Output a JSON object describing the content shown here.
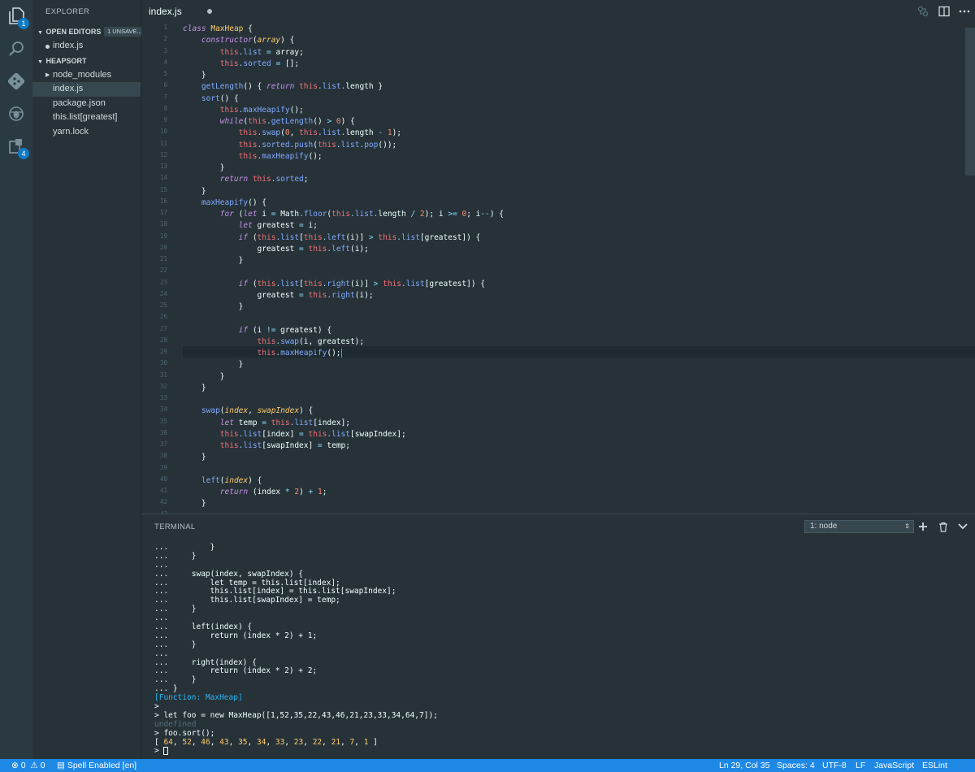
{
  "activity_bar": {
    "explorer_badge": "1",
    "extensions_badge": "4"
  },
  "sidebar": {
    "title": "EXPLORER",
    "open_editors": {
      "label": "OPEN EDITORS",
      "badge": "1 UNSAVE...",
      "items": [
        "index.js"
      ]
    },
    "project": {
      "label": "HEAPSORT",
      "items": [
        "node_modules",
        "index.js",
        "package.json",
        "this.list[greatest]",
        "yarn.lock"
      ]
    }
  },
  "tabs": [
    {
      "label": "index.js",
      "dirty": true
    }
  ],
  "editor": {
    "line_numbers": [
      "1",
      "2",
      "3",
      "4",
      "5",
      "6",
      "7",
      "8",
      "9",
      "10",
      "11",
      "12",
      "13",
      "14",
      "15",
      "16",
      "17",
      "18",
      "19",
      "20",
      "21",
      "22",
      "23",
      "24",
      "25",
      "26",
      "27",
      "28",
      "29",
      "30",
      "31",
      "32",
      "33",
      "34",
      "35",
      "36",
      "37",
      "38",
      "39",
      "40",
      "41",
      "42",
      "43"
    ],
    "lines": [
      "class MaxHeap {",
      "    constructor(array) {",
      "        this.list = array;",
      "        this.sorted = [];",
      "    }",
      "    getLength() { return this.list.length }",
      "    sort() {",
      "        this.maxHeapify();",
      "        while(this.getLength() > 0) {",
      "            this.swap(0, this.list.length - 1);",
      "            this.sorted.push(this.list.pop());",
      "            this.maxHeapify();",
      "        }",
      "        return this.sorted;",
      "    }",
      "    maxHeapify() {",
      "        for (let i = Math.floor(this.list.length / 2); i >= 0; i--) {",
      "            let greatest = i;",
      "            if (this.list[this.left(i)] > this.list[greatest]) {",
      "                greatest = this.left(i);",
      "            }",
      "",
      "            if (this.list[this.right(i)] > this.list[greatest]) {",
      "                greatest = this.right(i);",
      "            }",
      "",
      "            if (i != greatest) {",
      "                this.swap(i, greatest);",
      "                this.maxHeapify();",
      "            }",
      "        }",
      "    }",
      "",
      "    swap(index, swapIndex) {",
      "        let temp = this.list[index];",
      "        this.list[index] = this.list[swapIndex];",
      "        this.list[swapIndex] = temp;",
      "    }",
      "",
      "    left(index) {",
      "        return (index * 2) + 1;",
      "    }",
      ""
    ]
  },
  "panel": {
    "title": "TERMINAL",
    "terminal_select": "1: node",
    "lines": [
      "...         }",
      "...     }",
      "...",
      "...     swap(index, swapIndex) {",
      "...         let temp = this.list[index];",
      "...         this.list[index] = this.list[swapIndex];",
      "...         this.list[swapIndex] = temp;",
      "...     }",
      "...",
      "...     left(index) {",
      "...         return (index * 2) + 1;",
      "...     }",
      "...",
      "...     right(index) {",
      "...         return (index * 2) + 2;",
      "...     }",
      "... }",
      "[Function: MaxHeap]",
      ">",
      "> let foo = new MaxHeap([1,52,35,22,43,46,21,23,33,34,64,7]);",
      "undefined",
      "> foo.sort();",
      "[ 64, 52, 46, 43, 35, 34, 33, 23, 22, 21, 7, 1 ]",
      "> "
    ]
  },
  "status_bar": {
    "errors": "0",
    "warnings": "0",
    "spell": "Spell Enabled [en]",
    "position": "Ln 29, Col 35",
    "spaces": "Spaces: 4",
    "encoding": "UTF-8",
    "eol": "LF",
    "language": "JavaScript",
    "linter": "ESLint"
  }
}
